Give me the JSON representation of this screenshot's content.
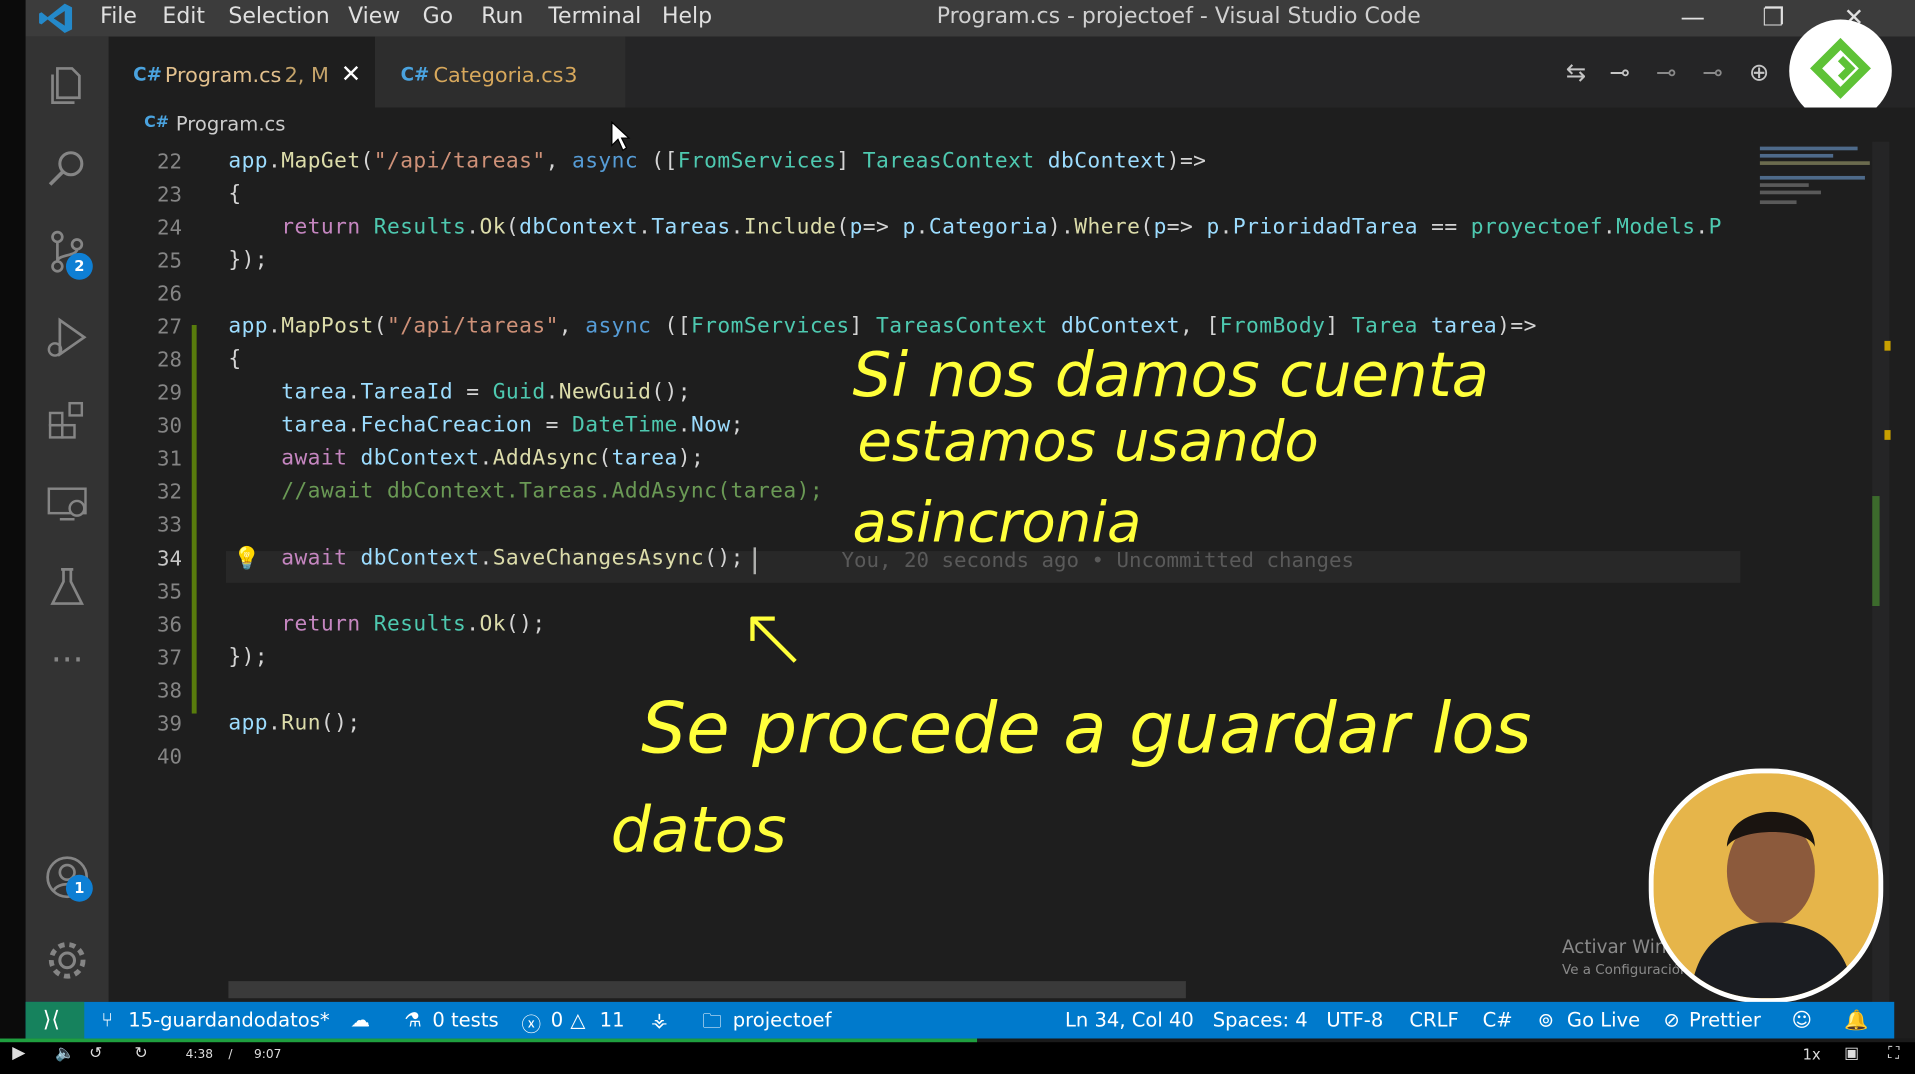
{
  "window": {
    "title": "Program.cs - projectoef - Visual Studio Code",
    "menu": [
      "File",
      "Edit",
      "Selection",
      "View",
      "Go",
      "Run",
      "Terminal",
      "Help"
    ]
  },
  "activity_bar": {
    "items": [
      "files-icon",
      "search-icon",
      "source-control-icon",
      "run-debug-icon",
      "extensions-icon",
      "remote-explorer-icon",
      "testing-icon",
      "more-icon"
    ],
    "source_control_badge": "2",
    "accounts_badge": "1"
  },
  "tabs": [
    {
      "label": "Program.cs",
      "status": "2, M",
      "active": true
    },
    {
      "label": "Categoria.cs",
      "status": "3",
      "active": false
    }
  ],
  "breadcrumb": "Program.cs",
  "editor": {
    "lines": [
      {
        "n": "22",
        "text": "app.MapGet(\"/api/tareas\", async ([FromServices] TareasContext dbContext)=>"
      },
      {
        "n": "23",
        "text": "{"
      },
      {
        "n": "24",
        "text": "    return Results.Ok(dbContext.Tareas.Include(p=> p.Categoria).Where(p=> p.PrioridadTarea == proyectoef.Models.P"
      },
      {
        "n": "25",
        "text": "});"
      },
      {
        "n": "26",
        "text": ""
      },
      {
        "n": "27",
        "text": "app.MapPost(\"/api/tareas\", async ([FromServices] TareasContext dbContext, [FromBody] Tarea tarea)=>"
      },
      {
        "n": "28",
        "text": "{"
      },
      {
        "n": "29",
        "text": "    tarea.TareaId = Guid.NewGuid();"
      },
      {
        "n": "30",
        "text": "    tarea.FechaCreacion = DateTime.Now;"
      },
      {
        "n": "31",
        "text": "    await dbContext.AddAsync(tarea);"
      },
      {
        "n": "32",
        "text": "    //await dbContext.Tareas.AddAsync(tarea);"
      },
      {
        "n": "33",
        "text": ""
      },
      {
        "n": "34",
        "text": "    await dbContext.SaveChangesAsync();"
      },
      {
        "n": "35",
        "text": ""
      },
      {
        "n": "36",
        "text": "    return Results.Ok();"
      },
      {
        "n": "37",
        "text": "});"
      },
      {
        "n": "38",
        "text": ""
      },
      {
        "n": "39",
        "text": "app.Run();"
      },
      {
        "n": "40",
        "text": ""
      }
    ],
    "blame": "You, 20 seconds ago • Uncommitted changes",
    "cursor_line": "34"
  },
  "annotations": {
    "line1": "Si nos damos cuenta",
    "line2": "estamos usando",
    "line3": "asincronia",
    "line4": "Se procede a guardar los",
    "line5": "datos",
    "arrow": "↖"
  },
  "status_bar": {
    "branch": "15-guardandodatos*",
    "tests": "0 tests",
    "errors": "0",
    "warnings": "11",
    "folder": "projectoef",
    "position": "Ln 34, Col 40",
    "spaces": "Spaces: 4",
    "encoding": "UTF-8",
    "eol": "CRLF",
    "language": "C#",
    "golive": "Go Live",
    "prettier": "Prettier"
  },
  "watermark": {
    "title": "Activar Windows",
    "subtitle": "Ve a Configuración para activar Windows."
  },
  "player": {
    "current": "4:38",
    "separator": "/",
    "total": "9:07",
    "speed": "1x",
    "progress": 0.51
  }
}
